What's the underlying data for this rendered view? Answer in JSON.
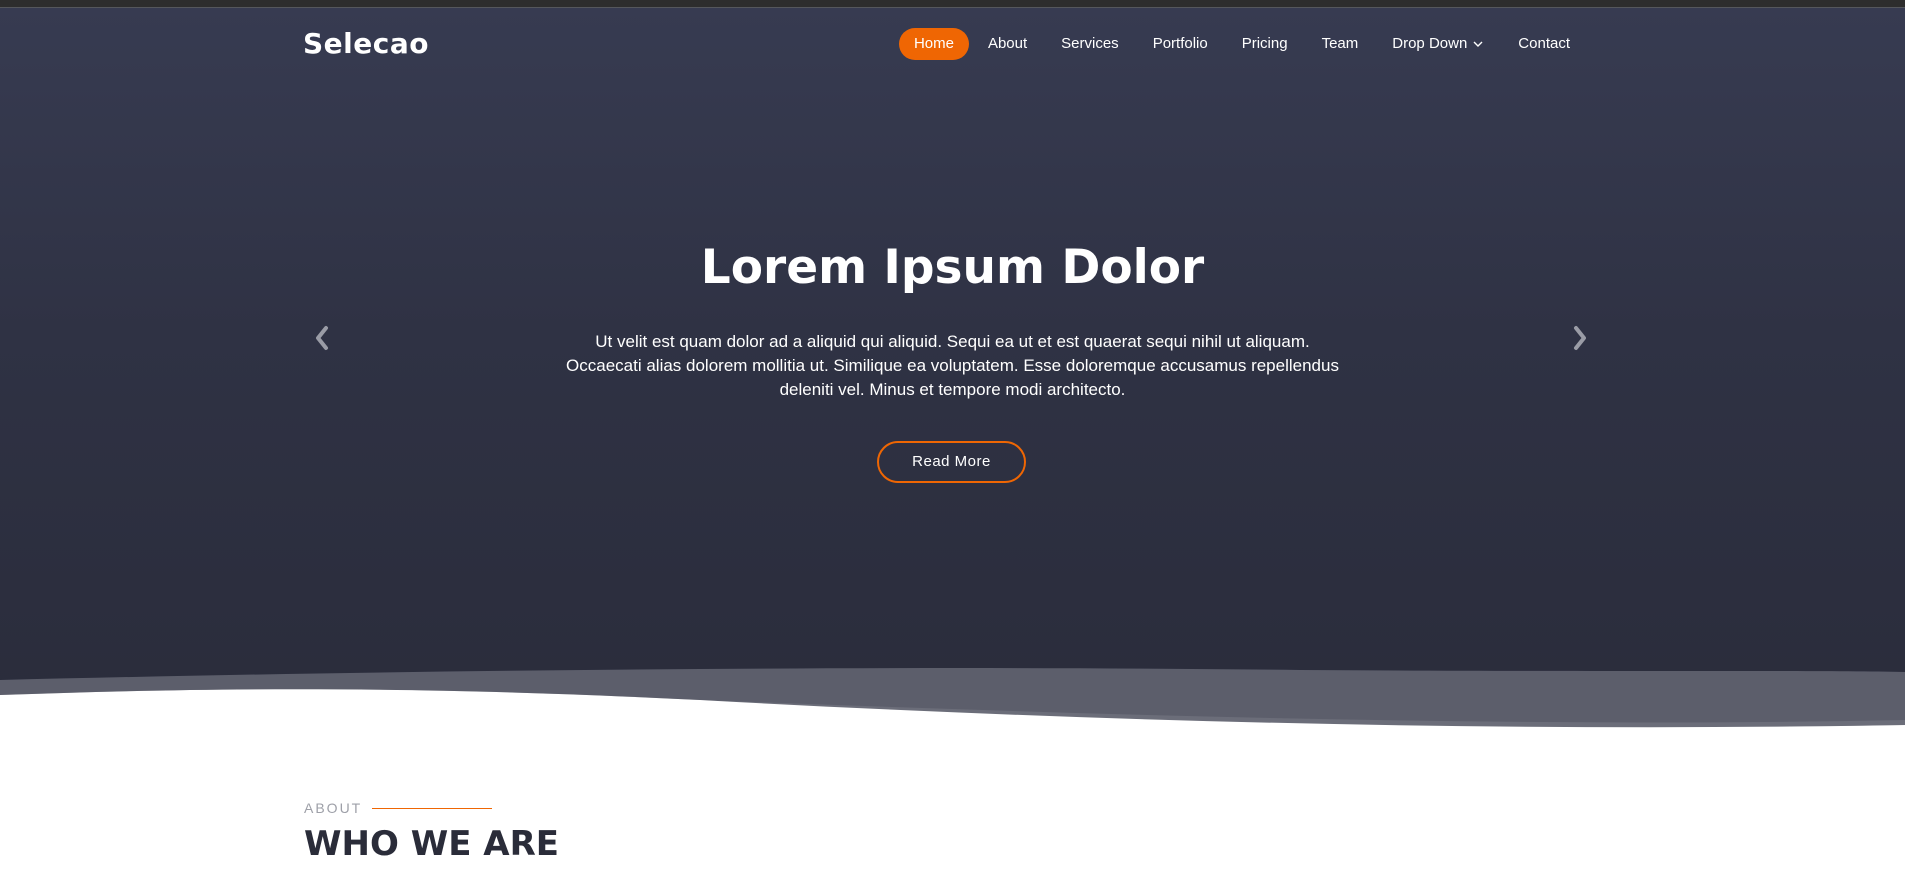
{
  "brand": {
    "name": "Selecao"
  },
  "nav": {
    "items": [
      {
        "label": "Home"
      },
      {
        "label": "About"
      },
      {
        "label": "Services"
      },
      {
        "label": "Portfolio"
      },
      {
        "label": "Pricing"
      },
      {
        "label": "Team"
      },
      {
        "label": "Drop Down"
      },
      {
        "label": "Contact"
      }
    ]
  },
  "hero": {
    "title": "Lorem Ipsum Dolor",
    "text": "Ut velit est quam dolor ad a aliquid qui aliquid. Sequi ea ut et est quaerat sequi nihil ut aliquam. Occaecati alias dolorem mollitia ut. Similique ea voluptatem. Esse doloremque accusamus repellendus deleniti vel. Minus et tempore modi architecto.",
    "button_label": "Read More",
    "prev_icon": "chevron-left-icon",
    "next_icon": "chevron-right-icon"
  },
  "about": {
    "label": "ABOUT",
    "title": "WHO WE ARE"
  },
  "colors": {
    "accent": "#ef6603",
    "hero_bg": "#2f3244",
    "heading_dark": "#2a2c39"
  }
}
